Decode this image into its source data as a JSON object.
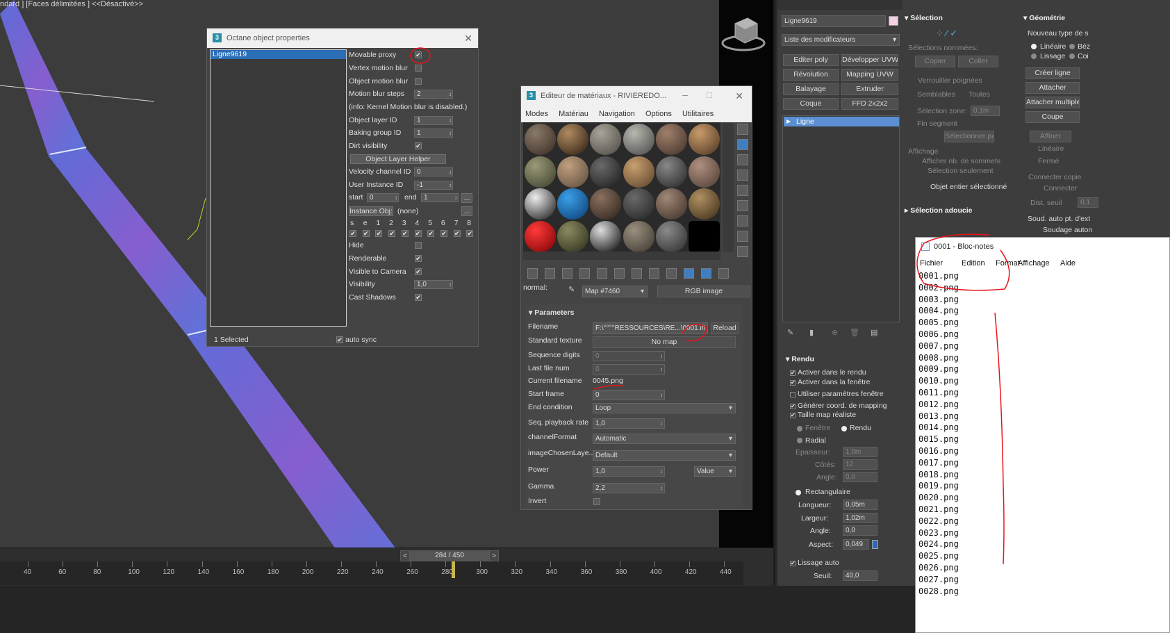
{
  "viewport": {
    "label": "ndard ] [Faces délimitées ]  <<Désactivé>>"
  },
  "timeline": {
    "frame": "284 / 450",
    "prev": "<",
    "next": ">",
    "ticks": [
      "40",
      "60",
      "80",
      "100",
      "120",
      "140",
      "160",
      "180",
      "200",
      "220",
      "240",
      "260",
      "280",
      "300",
      "320",
      "340",
      "360",
      "380",
      "400",
      "420",
      "440"
    ]
  },
  "octane": {
    "title": "Octane object properties",
    "object": "Ligne9619",
    "movable_proxy": "Movable proxy",
    "vertex_motion_blur": "Vertex motion blur",
    "object_motion_blur": "Object motion blur",
    "motion_blur_steps": "Motion blur steps",
    "motion_blur_steps_val": "2",
    "info": "(info: Kernel Motion blur is disabled.)",
    "object_layer_id": "Object layer ID",
    "object_layer_id_val": "1",
    "baking_group_id": "Baking group ID",
    "baking_group_id_val": "1",
    "dirt_visibility": "Dirt visibility",
    "layer_helper": "Object Layer Helper",
    "velocity_channel_id": "Velocity channel ID",
    "velocity_channel_id_val": "0",
    "user_instance_id": "User Instance ID",
    "user_instance_id_val": "-1",
    "start": "start",
    "start_val": "0",
    "end": "end",
    "end_val": "1",
    "ellipsis": "...",
    "instance_obj": "Instance Obj:",
    "instance_none": "(none)",
    "cols": [
      "s",
      "e",
      "1",
      "2",
      "3",
      "4",
      "5",
      "6",
      "7",
      "8"
    ],
    "hide": "Hide",
    "renderable": "Renderable",
    "visible_to_camera": "Visible to Camera",
    "visibility": "Visibility",
    "visibility_val": "1,0",
    "cast_shadows": "Cast Shadows",
    "status": "1 Selected",
    "auto_sync": "auto sync",
    "check": "✔"
  },
  "mated": {
    "title": "Editeur de matériaux - RIVIEREDO...",
    "menu": [
      "Modes",
      "Matériau",
      "Navigation",
      "Options",
      "Utilitaires"
    ],
    "normal_label": "normal:",
    "map_name": "Map #7460",
    "map_type": "RGB image",
    "params_header": "Parameters",
    "filename_lbl": "Filename",
    "filename_val": "F:\\°°°°RESSOURCES\\RE...\\0001.ifl",
    "reload": "Reload",
    "standard_texture_lbl": "Standard texture",
    "no_map": "No map",
    "sequence_digits_lbl": "Sequence digits",
    "sequence_digits_val": "0",
    "last_file_num_lbl": "Last file num",
    "last_file_num_val": "0",
    "current_filename_lbl": "Current filename",
    "current_filename_val": "0045.png",
    "start_frame_lbl": "Start frame",
    "start_frame_val": "0",
    "end_condition_lbl": "End condition",
    "end_condition_val": "Loop",
    "seq_playback_lbl": "Seq. playback rate",
    "seq_playback_val": "1,0",
    "channel_format_lbl": "channelFormat",
    "channel_format_val": "Automatic",
    "image_layer_lbl": "imageChosenLaye...",
    "image_layer_val": "Default",
    "power_lbl": "Power",
    "power_val": "1,0",
    "power_mode": "Value",
    "gamma_lbl": "Gamma",
    "gamma_val": "2,2",
    "invert_lbl": "Invert"
  },
  "cmd": {
    "object_name": "Ligne9619",
    "modifier_list": "Liste des modificateurs",
    "buttons": [
      "Editer poly",
      "Développer UVW",
      "Révolution",
      "Mapping UVW",
      "Balayage",
      "Extruder",
      "Coque",
      "FFD 2x2x2"
    ],
    "stack_item": "Ligne",
    "selection_header": "Sélection",
    "named_selections": "Sélections nommées:",
    "copy": "Copier",
    "paste": "Coller",
    "lock_handles": "Verrouiller poignées",
    "alike": "Semblables",
    "all": "Toutes",
    "area_sel": "Sélection zone:",
    "area_val": "0,1m",
    "segment_end": "Fin segment",
    "select_by": "Sélectionner par...",
    "display": "Affichage",
    "show_vertex_numbers": "Afficher nb. de sommets",
    "selected_only": "Sélection seulement",
    "whole_object": "Objet entier sélectionné",
    "soft_selection": "Sélection adoucie",
    "geometry_header": "Géométrie",
    "new_vertex_type": "Nouveau type de s",
    "linear": "Linéaire",
    "bezier": "Béz",
    "smooth": "Lissage",
    "corner": "Coi",
    "create_line": "Créer ligne",
    "attach": "Attacher",
    "attach_multiple": "Attacher multiple",
    "cut": "Coupe",
    "refine": "Affiner",
    "r_linear": "Linéaire",
    "closed": "Fermé",
    "connect_copy": "Connecter copie",
    "connect": "Connecter",
    "thresh": "Dist. seuil",
    "thresh_val": "0,1",
    "auto_weld": "Soud. auto pt. d'ext",
    "weld_auto": "Soudage auton",
    "render_header": "Rendu",
    "enable_render": "Activer dans le rendu",
    "enable_viewport": "Activer dans la fenêtre",
    "use_viewport_settings": "Utiliser paramètres fenêtre",
    "gen_mapping": "Générer coord. de mapping",
    "real_world": "Taille map réaliste",
    "viewport": "Fenêtre",
    "renderer": "Rendu",
    "radial": "Radial",
    "thickness": "Epaisseur:",
    "thickness_val": "1,0m",
    "sides": "Côtés:",
    "sides_val": "12",
    "angle": "Angle:",
    "angle_val": "0,0",
    "rectangular": "Rectangulaire",
    "length": "Longueur:",
    "length_val": "0,05m",
    "width": "Largeur:",
    "width_val": "1,02m",
    "r_angle": "Angle:",
    "r_angle_val": "0,0",
    "aspect": "Aspect:",
    "aspect_val": "0,049",
    "auto_smooth": "Lissage auto",
    "threshold": "Seuil:",
    "threshold_val": "40,0",
    "check": "✔"
  },
  "notepad": {
    "title": "0001 - Bloc-notes",
    "menu": [
      "Fichier",
      "Edition",
      "Format",
      "Affichage",
      "Aide"
    ],
    "content": "0001.png\n0002.png\n0003.png\n0004.png\n0005.png\n0006.png\n0007.png\n0008.png\n0009.png\n0010.png\n0011.png\n0012.png\n0013.png\n0014.png\n0015.png\n0016.png\n0017.png\n0018.png\n0019.png\n0020.png\n0021.png\n0022.png\n0023.png\n0024.png\n0025.png\n0026.png\n0027.png\n0028.png"
  },
  "colors": {
    "annotation_red": "#e8141c",
    "selection_blue": "#2b6fb8",
    "road_blue": "#6f63d8"
  }
}
